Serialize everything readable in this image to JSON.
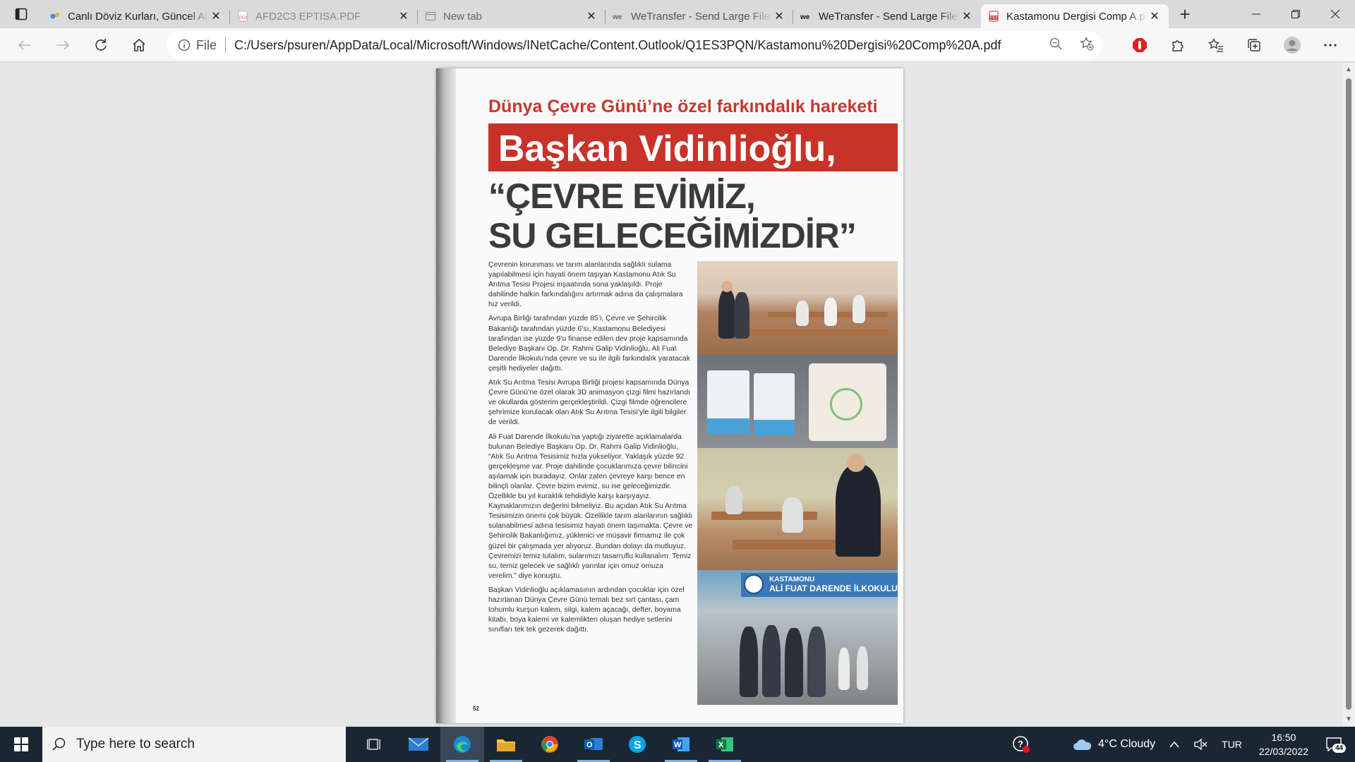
{
  "browser": {
    "tabs": [
      {
        "title": "Canlı Döviz Kurları, Güncel Altın",
        "icon": "exchange-icon",
        "active": false
      },
      {
        "title": "AFD2C3 EPTISA.PDF",
        "icon": "pdf-icon",
        "active": false
      },
      {
        "title": "New tab",
        "icon": "newtab-icon",
        "active": false
      },
      {
        "title": "WeTransfer - Send Large Files",
        "icon": "wetransfer-icon",
        "active": false
      },
      {
        "title": "WeTransfer - Send Large Files",
        "icon": "wetransfer-icon",
        "active": false
      },
      {
        "title": "Kastamonu Dergisi Comp A.pdf",
        "icon": "pdf-icon",
        "active": true
      }
    ],
    "new_tab_symbol": "+",
    "address": {
      "scheme_label": "File",
      "url": "C:/Users/psuren/AppData/Local/Microsoft/Windows/INetCache/Content.Outlook/Q1ES3PQN/Kastamonu%20Dergisi%20Comp%20A.pdf"
    }
  },
  "article": {
    "kicker": "Dünya Çevre Günü’ne özel farkındalık hareketi",
    "headline": "Başkan Vidinlioğlu,",
    "quote_line1": "“ÇEVRE EVİMİZ,",
    "quote_line2": "SU GELECEĞİMİZDİR”",
    "paragraphs": [
      "Çevrenin korunması ve tarım alanlarında sağlıklı sulama yapılabilmesi için hayati önem taşıyan Kastamonu Atık Su Arıtma Tesisi Projesi inşaatında sona yaklaşıldı. Proje dahilinde halkın farkındalığını artırmak adına da çalışmalara hız verildi.",
      "Avrupa Birliği tarafından yüzde 85’i, Çevre ve Şehircilik Bakanlığı tarafından yüzde 6’sı, Kastamonu Belediyesi tarafından ise yüzde 9’u finanse edilen dev proje kapsamında Belediye Başkanı Op. Dr. Rahmi Galip Vidinlioğlu, Ali Fuat Darende İlkokulu’nda çevre ve su ile ilgili farkındalık yaratacak çeşitli hediyeler dağıttı.",
      "Atık Su Arıtma Tesisi Avrupa Birliği projesi kapsamında Dünya Çevre Günü’ne özel olarak 3D animasyon çizgi filmi hazırlandı ve okullarda gösterim gerçekleştirildi. Çizgi filmde öğrencilere şehrimize kurulacak olan Atık Su Arıtma Tesisi’yle ilgili bilgiler de verildi.",
      "Ali Fuat Darende İlkokulu’na yaptığı ziyarette açıklamalarda bulunan Belediye Başkanı Op. Dr. Rahmi Galip Vidinlioğlu, “Atık Su Arıtma Tesisimiz hızla yükseliyor. Yaklaşık yüzde 92 gerçekleşme var. Proje dahilinde çocuklarımıza çevre bilincini aşılamak için buradayız. Onlar zaten çevreye karşı bence en bilinçli olanlar. Çevre bizim evimiz, su ise geleceğimizdir. Özellikle bu yıl kuraklık tehdidiyle karşı karşıyayız. Kaynaklarımızın değerini bilmeliyiz. Bu açıdan Atık Su Arıtma Tesisimizin önemi çok büyük. Özellikle tarım alanlarının sağlıklı sulanabilmesi adına tesisimiz hayati önem taşımakta. Çevre ve Şehircilik Bakanlığımız, yüklenici ve müşavir firmamız ile çok güzel bir çalışmada yer alıyoruz. Bundan dolayı da mutluyuz. Çevremizi temiz tutalım, sularımızı tasarruflu kullanalım. Temiz su, temiz gelecek ve sağlıklı yarınlar için omuz omuza verelim.” diye konuştu.",
      "Başkan Vidinlioğlu açıklamasının ardından çocuklar için özel hazırlanan Dünya Çevre Günü temalı bez sırt çantası, çam tohumlu kurşun kalem, silgi, kalem açacağı, defter, boyama kitabı, boya kalemi ve kalemlikten oluşan hediye setlerini sınıfları tek tek gezerek dağıttı."
    ],
    "sign_line1": "KASTAMONU",
    "sign_line2": "ALİ FUAT DARENDE İLKOKULU",
    "page_number": "52"
  },
  "taskbar": {
    "search_placeholder": "Type here to search",
    "apps": [
      "task-view-icon",
      "mail-icon",
      "edge-icon",
      "file-explorer-icon",
      "chrome-icon",
      "outlook-icon",
      "skype-icon",
      "word-icon",
      "excel-icon"
    ],
    "weather": "4°C  Cloudy",
    "language": "TUR",
    "time": "16:50",
    "date": "22/03/2022",
    "notification_count": "44"
  },
  "colors": {
    "accent_red": "#c83228",
    "taskbar_bg": "#1b2633"
  }
}
